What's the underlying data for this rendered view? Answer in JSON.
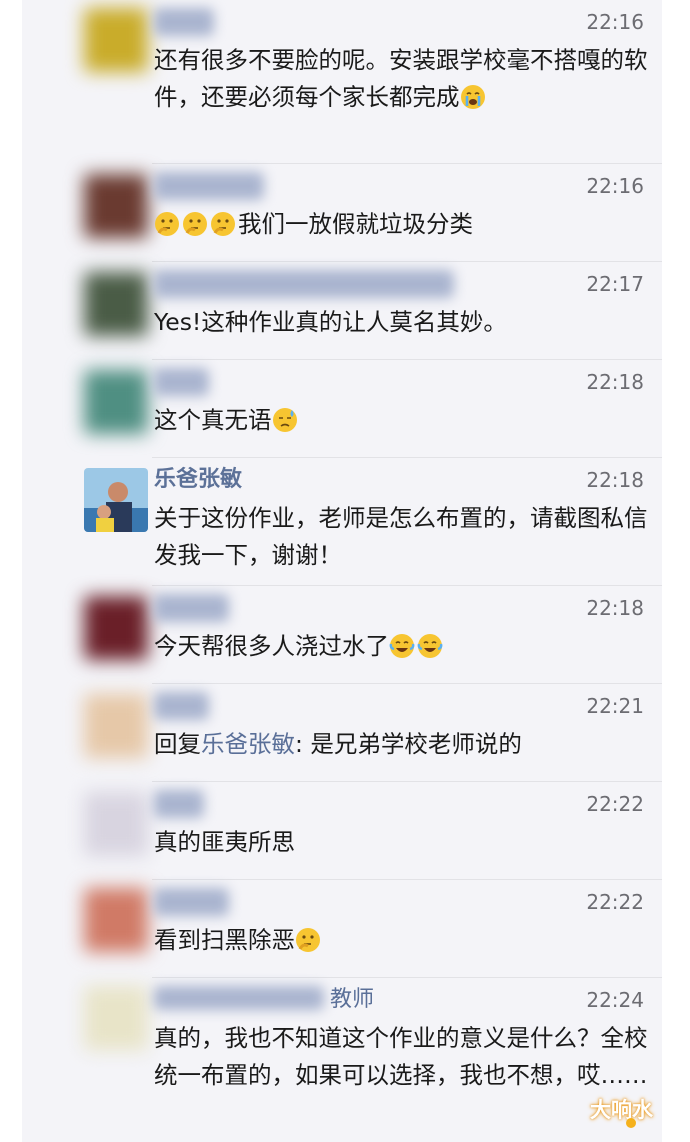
{
  "comments": [
    {
      "name": "",
      "time": "22:16",
      "text": "还有很多不要脸的呢。安装跟学校毫不搭嘎的软件，还要必须每个家长都完成",
      "emoji_after": [
        "crying-face-icon"
      ],
      "avatar_color": "#c9ac2a"
    },
    {
      "name": "",
      "time": "22:16",
      "emoji_before": [
        "thinking-face-icon",
        "thinking-face-icon",
        "thinking-face-icon"
      ],
      "text": "我们一放假就垃圾分类",
      "avatar_color": "#6a3a30"
    },
    {
      "name": "",
      "time": "22:17",
      "text": "Yes!这种作业真的让人莫名其妙。",
      "avatar_color": "#4a5c46"
    },
    {
      "name": "",
      "time": "22:18",
      "text": "这个真无语",
      "emoji_after": [
        "sweat-face-icon"
      ],
      "avatar_color": "#4f8f82"
    },
    {
      "name": "乐爸张敏",
      "time": "22:18",
      "text": "关于这份作业，老师是怎么布置的，请截图私信发我一下，谢谢！"
    },
    {
      "name": "",
      "time": "22:18",
      "text": "今天帮很多人浇过水了",
      "emoji_after": [
        "tears-of-joy-icon",
        "tears-of-joy-icon"
      ],
      "avatar_color": "#6a1f28"
    },
    {
      "name": "",
      "time": "22:21",
      "reply_prefix": "回复",
      "reply_name": "乐爸张敏",
      "text": ": 是兄弟学校老师说的",
      "avatar_color": "#e6c8a8"
    },
    {
      "name": "",
      "time": "22:22",
      "text": "真的匪夷所思",
      "avatar_color": "#d8d4e0"
    },
    {
      "name": "",
      "time": "22:22",
      "text": "看到扫黑除恶",
      "emoji_after": [
        "thinking-face-icon"
      ],
      "avatar_color": "#d07a66"
    },
    {
      "name": "教师",
      "time": "22:24",
      "text": "真的，我也不知道这个作业的意义是什么？全校统一布置的，如果可以选择，我也不想，哎……",
      "avatar_color": "#e8e4c8"
    }
  ],
  "watermark": "大响水"
}
